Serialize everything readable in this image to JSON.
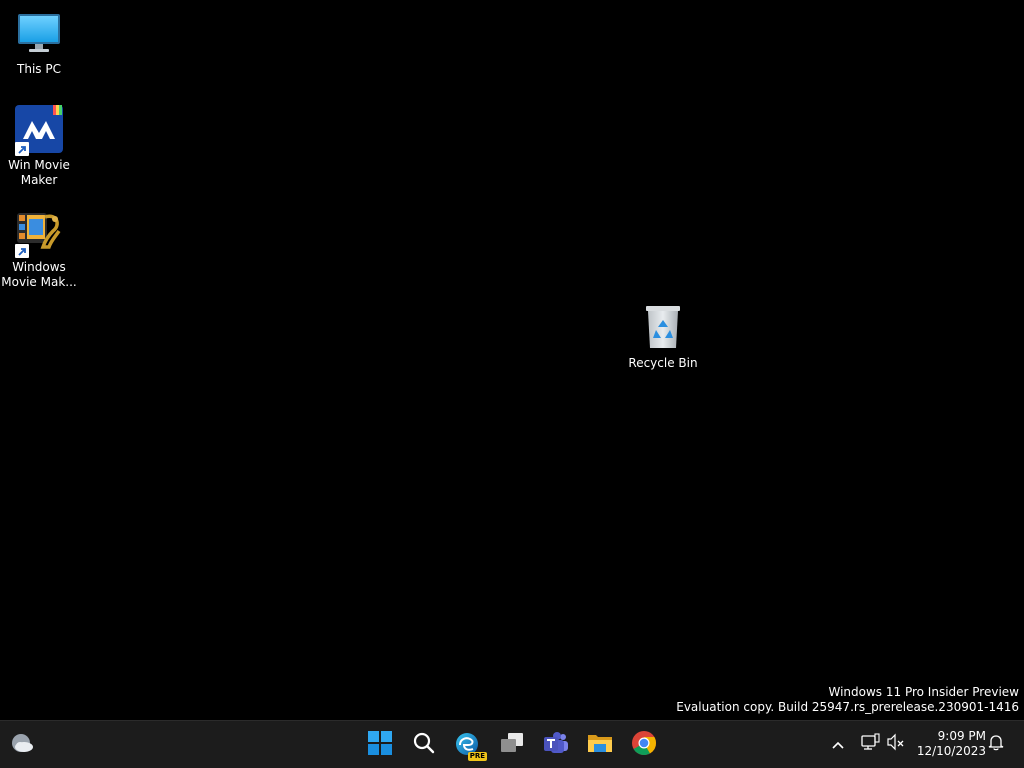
{
  "desktop": {
    "icons": [
      {
        "label_line1": "This PC",
        "label_line2": "",
        "icon": "monitor-icon"
      },
      {
        "label_line1": "Win Movie",
        "label_line2": "Maker",
        "icon": "win-movie-maker-icon"
      },
      {
        "label_line1": "Windows",
        "label_line2": "Movie Mak...",
        "icon": "windows-movie-maker-icon"
      },
      {
        "label_line1": "Recycle Bin",
        "label_line2": "",
        "icon": "recycle-bin-icon"
      }
    ]
  },
  "watermark": {
    "line1": "Windows 11 Pro Insider Preview",
    "line2": "Evaluation copy. Build 25947.rs_prerelease.230901-1416"
  },
  "taskbar": {
    "widgets_icon": "weather-cloud-icon",
    "apps": [
      {
        "name": "Start",
        "icon": "windows-start-icon"
      },
      {
        "name": "Search",
        "icon": "search-icon"
      },
      {
        "name": "Microsoft Edge",
        "icon": "edge-pre-icon",
        "badge": "PRE"
      },
      {
        "name": "Task View",
        "icon": "task-view-icon"
      },
      {
        "name": "Microsoft Teams",
        "icon": "teams-icon"
      },
      {
        "name": "File Explorer",
        "icon": "file-explorer-icon"
      },
      {
        "name": "Google Chrome",
        "icon": "chrome-icon"
      }
    ],
    "tray": {
      "chevron_icon": "chevron-up-icon",
      "network_icon": "network-icon",
      "volume_icon": "volume-muted-icon",
      "time": "9:09 PM",
      "date": "12/10/2023",
      "notification_icon": "bell-icon"
    }
  },
  "colors": {
    "desktop_bg": "#000000",
    "taskbar_bg": "#1c1c1c",
    "accent_blue": "#0078d4"
  }
}
